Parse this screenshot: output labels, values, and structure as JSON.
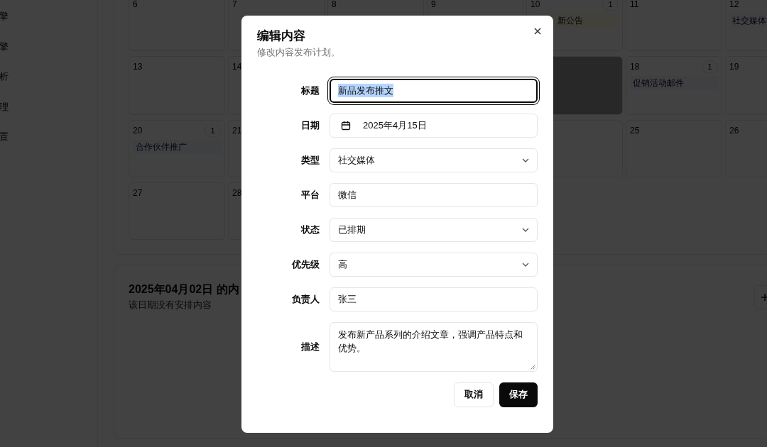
{
  "sidebar": {
    "items": [
      {
        "label": "擎"
      },
      {
        "label": "擎"
      },
      {
        "label": "析"
      },
      {
        "label": "理"
      },
      {
        "label": "置"
      }
    ]
  },
  "calendar": {
    "weeks": [
      {
        "cells": [
          {
            "day": "6",
            "selected": false
          },
          {
            "day": "7",
            "selected": false
          },
          {
            "day": "8",
            "selected": false
          },
          {
            "day": "9",
            "selected": false
          },
          {
            "day": "10",
            "count": "1",
            "selected": false,
            "events": [
              {
                "label": "新公告",
                "kind": "announcement"
              }
            ]
          },
          {
            "day": "11",
            "selected": false
          },
          {
            "day": "12",
            "selected": false,
            "events": [
              {
                "label": "社交媒体",
                "kind": "social"
              }
            ]
          }
        ]
      },
      {
        "cells": [
          {
            "day": "13",
            "selected": false
          },
          {
            "day": "14",
            "selected": false
          },
          {},
          {},
          {
            "selected": true
          },
          {
            "day": "18",
            "count": "1",
            "selected": false,
            "events": [
              {
                "label": "促销活动邮件",
                "kind": "email"
              }
            ]
          },
          {
            "day": "19",
            "selected": false
          }
        ]
      },
      {
        "cells": [
          {
            "day": "20",
            "count": "1",
            "selected": false,
            "events": [
              {
                "label": "合作伙伴推广",
                "kind": "partner"
              }
            ]
          },
          {
            "day": "21",
            "selected": false
          },
          {},
          {},
          {
            "selected": false
          },
          {
            "day": "25",
            "selected": false
          },
          {
            "day": "26",
            "selected": false
          }
        ]
      },
      {
        "cells": [
          {
            "day": "27",
            "selected": false
          },
          {
            "day": "28",
            "selected": false
          },
          {},
          {}
        ]
      }
    ]
  },
  "day_panel": {
    "title": "2025年04月02日 的内",
    "empty_text": "该日期没有安排内容"
  },
  "dialog": {
    "title": "编辑内容",
    "subtitle": "修改内容发布计划。",
    "fields": [
      {
        "label": "标题",
        "kind": "text",
        "value": "新品发布推文",
        "focused": true
      },
      {
        "label": "日期",
        "kind": "date",
        "value": "2025年4月15日"
      },
      {
        "label": "类型",
        "kind": "select",
        "value": "社交媒体"
      },
      {
        "label": "平台",
        "kind": "text",
        "value": "微信",
        "focused": false
      },
      {
        "label": "状态",
        "kind": "select",
        "value": "已排期"
      },
      {
        "label": "优先级",
        "kind": "select",
        "value": "高"
      },
      {
        "label": "负责人",
        "kind": "text",
        "value": "张三",
        "focused": false
      },
      {
        "label": "描述",
        "kind": "textarea",
        "value": "发布新产品系列的介绍文章，强调产品特点和优势。"
      }
    ],
    "buttons": [
      {
        "label": "取消",
        "kind": "secondary"
      },
      {
        "label": "保存",
        "kind": "primary"
      }
    ]
  }
}
